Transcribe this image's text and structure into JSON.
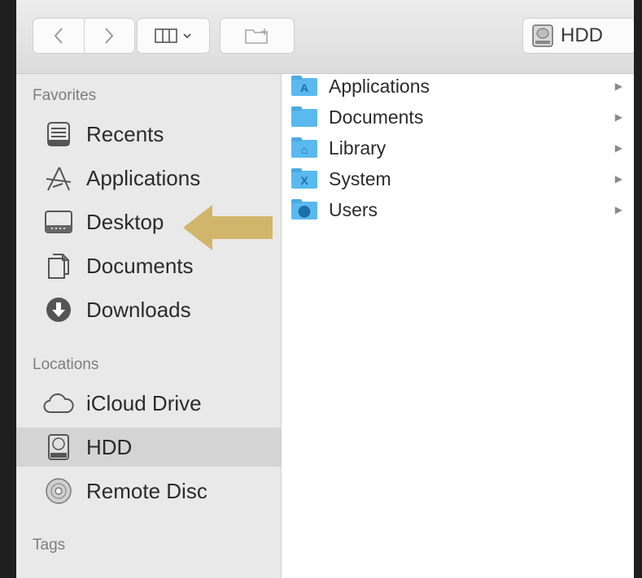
{
  "toolbar": {
    "back_icon": "chevron-left-icon",
    "forward_icon": "chevron-right-icon",
    "view_icon": "column-view-icon",
    "new_folder_icon": "new-folder-icon",
    "path_label": "HDD",
    "path_icon": "hard-drive-icon"
  },
  "sidebar": {
    "favorites_title": "Favorites",
    "favorites": [
      {
        "label": "Recents",
        "icon": "recents-icon"
      },
      {
        "label": "Applications",
        "icon": "applications-icon"
      },
      {
        "label": "Desktop",
        "icon": "desktop-icon"
      },
      {
        "label": "Documents",
        "icon": "documents-icon"
      },
      {
        "label": "Downloads",
        "icon": "downloads-icon"
      }
    ],
    "locations_title": "Locations",
    "locations": [
      {
        "label": "iCloud Drive",
        "icon": "cloud-icon"
      },
      {
        "label": "HDD",
        "icon": "hard-drive-icon",
        "selected": true
      },
      {
        "label": "Remote Disc",
        "icon": "disc-icon"
      }
    ],
    "tags_title": "Tags"
  },
  "files": [
    {
      "label": "Applications",
      "icon": "applications-folder-icon"
    },
    {
      "label": "Documents",
      "icon": "folder-icon"
    },
    {
      "label": "Library",
      "icon": "library-folder-icon"
    },
    {
      "label": "System",
      "icon": "system-folder-icon"
    },
    {
      "label": "Users",
      "icon": "users-folder-icon"
    }
  ],
  "annotation": {
    "arrow_color": "#d1b56a",
    "points_to": "Desktop"
  },
  "colors": {
    "folder": "#5ab9ee",
    "selection": "#d4d4d4",
    "sidebar_bg": "#e9e9e9",
    "background": "#1f1f1f"
  }
}
